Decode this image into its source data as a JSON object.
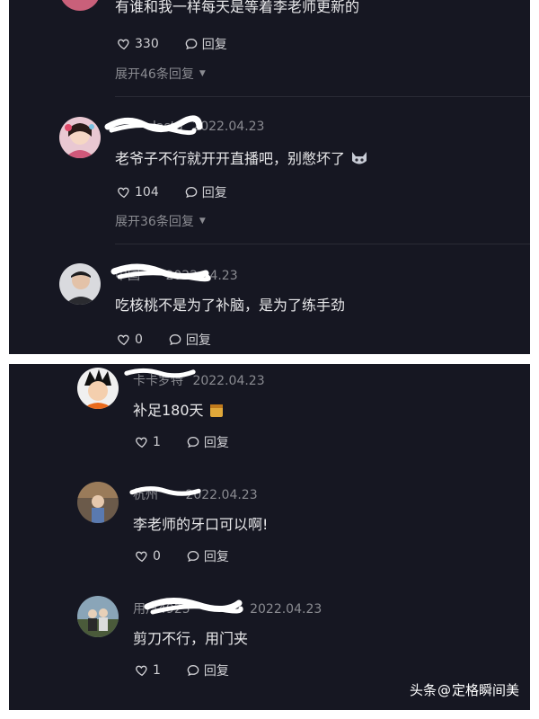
{
  "top": {
    "cut_comment": {
      "text": "有谁和我一样每天是等着李老师更新的",
      "likes": "330",
      "reply_label": "回复",
      "expand_label": "展开46条回复"
    },
    "comment1": {
      "username": "lasta",
      "date": "2022.04.23",
      "text": "老爷子不行就开开直播吧，别憋坏了",
      "likes": "104",
      "reply_label": "回复",
      "expand_label": "展开36条回复"
    },
    "comment2": {
      "username": "中国",
      "date": "2022.04.23",
      "text": "吃核桃不是为了补脑，是为了练手劲",
      "likes": "0",
      "reply_label": "回复"
    }
  },
  "bottom": {
    "comment3": {
      "username": "卡卡罗特",
      "date": "2022.04.23",
      "text": "补足180天",
      "likes": "1",
      "reply_label": "回复"
    },
    "comment4": {
      "username": "杭州",
      "date": "2022.04.23",
      "text": "李老师的牙口可以啊!",
      "likes": "0",
      "reply_label": "回复"
    },
    "comment5": {
      "username": "用户4925",
      "date": "2022.04.23",
      "text": "剪刀不行，用门夹",
      "likes": "1",
      "reply_label": "回复"
    }
  },
  "watermark": {
    "brand": "头条",
    "at": "@",
    "author": "定格瞬间美"
  },
  "colors": {
    "background": "#161722",
    "text": "#e8e8ea",
    "muted": "#8a8b91"
  }
}
